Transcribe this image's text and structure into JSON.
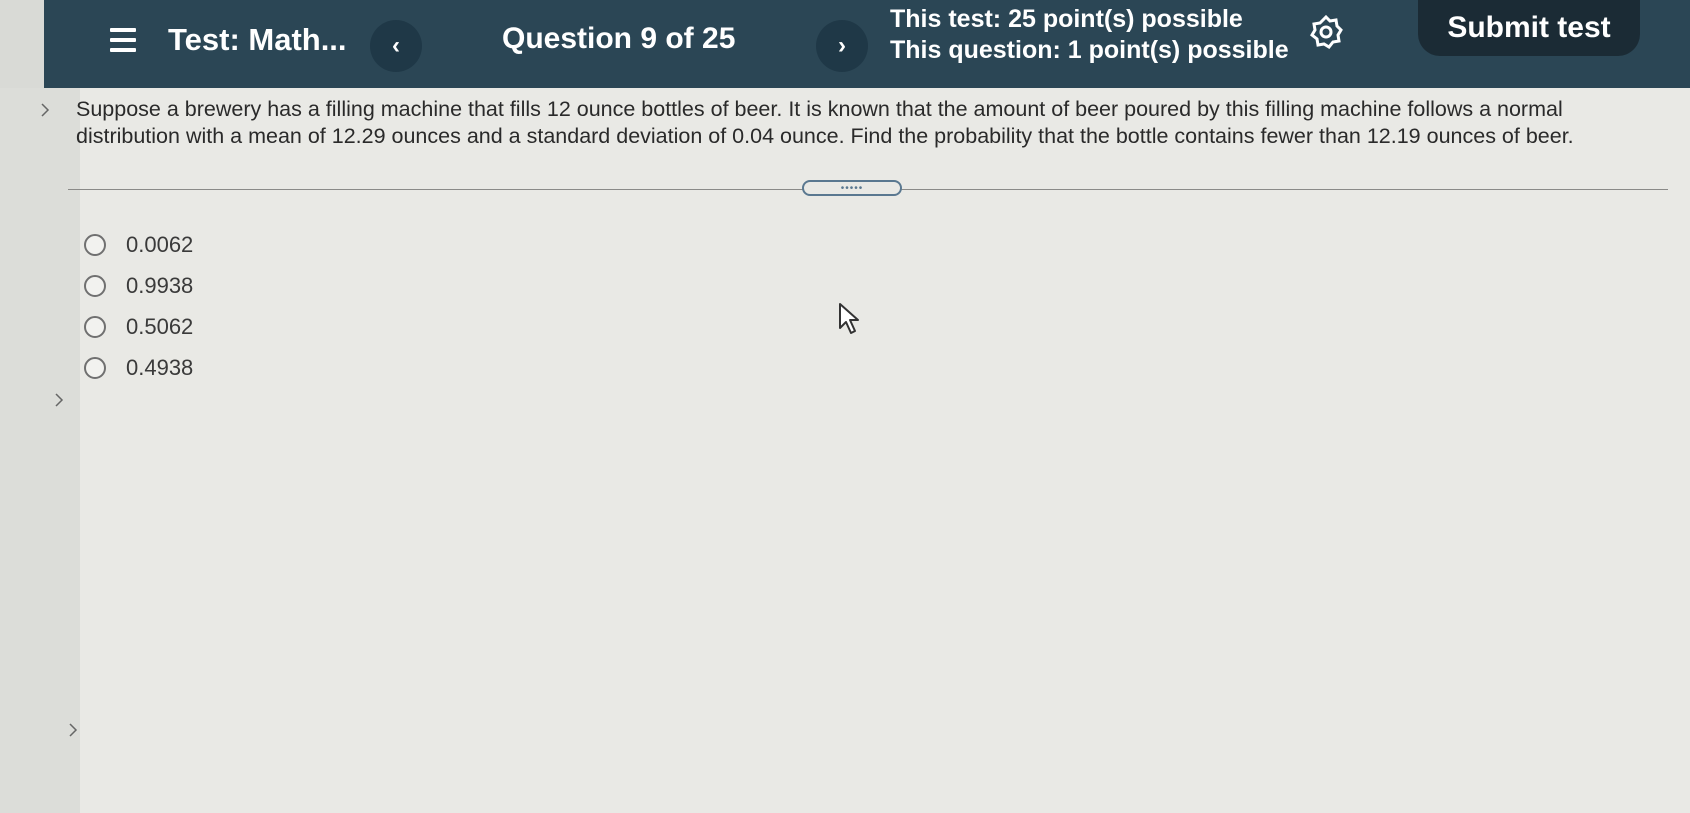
{
  "header": {
    "test_title": "Test: Math...",
    "prev_label": "‹",
    "question_counter": "Question 9 of 25",
    "next_label": "›",
    "test_points": "This test: 25 point(s) possible",
    "question_points": "This question: 1 point(s) possible",
    "submit_label": "Submit test",
    "menu_icon": "hamburger-menu-icon",
    "settings_icon": "gear-icon"
  },
  "question": {
    "text": "Suppose a brewery has a filling machine that fills 12 ounce bottles of beer. It is known that the amount of beer poured by this filling machine follows a normal distribution with a mean of 12.29 ounces and a standard deviation of 0.04 ounce. Find the probability that the bottle contains fewer than 12.19 ounces of beer."
  },
  "divider": {
    "grip_label": "•••••"
  },
  "options": [
    {
      "label": "0.0062"
    },
    {
      "label": "0.9938"
    },
    {
      "label": "0.5062"
    },
    {
      "label": "0.4938"
    }
  ],
  "colors": {
    "header_bg": "#2b4655",
    "submit_bg": "#1b2b35",
    "page_bg": "#e9e9e5"
  }
}
